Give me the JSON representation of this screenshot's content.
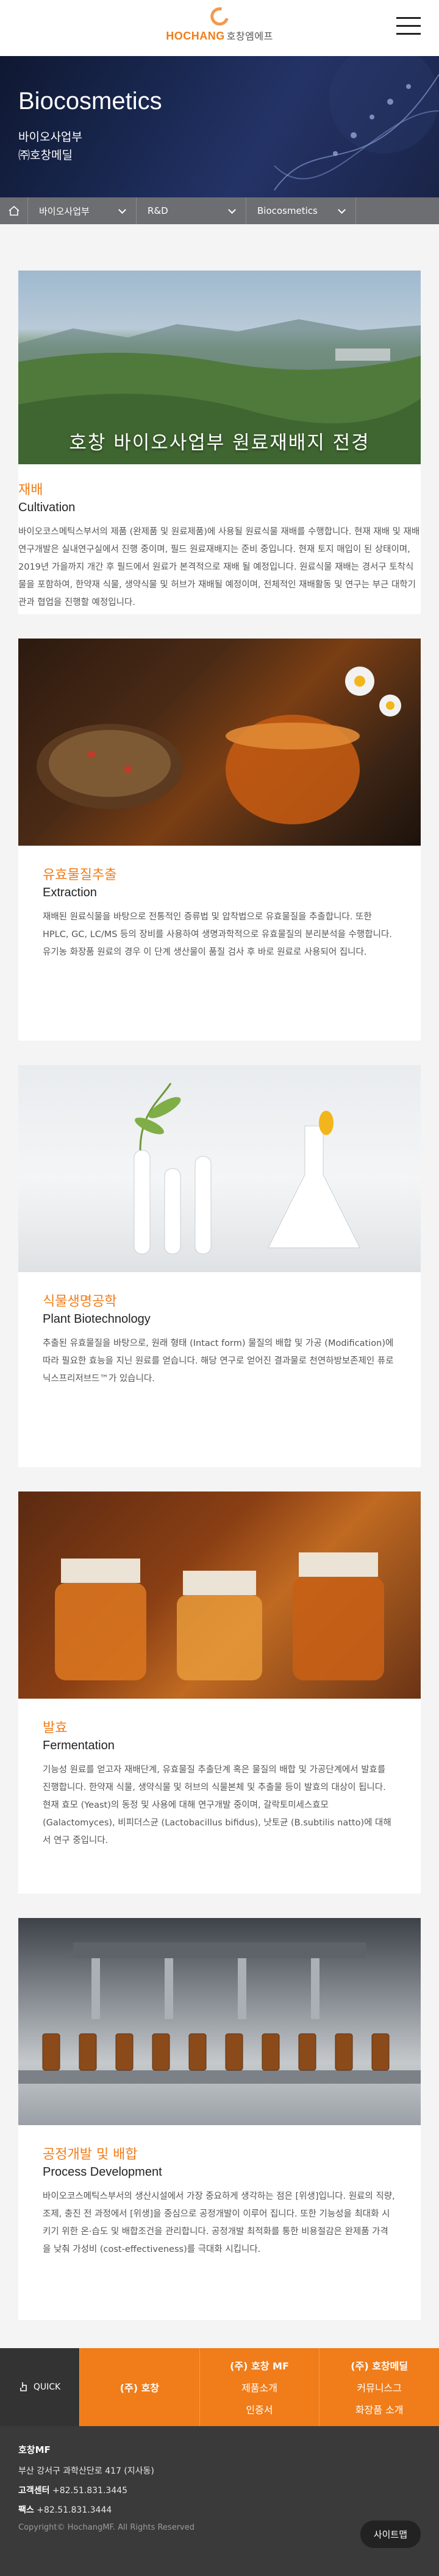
{
  "brand": {
    "name": "HOCHANG",
    "sub": "호창엠에프"
  },
  "hero": {
    "title": "Biocosmetics",
    "line1": "바이오사업부",
    "line2": "㈜호창메딜"
  },
  "breadcrumb": {
    "items": [
      "바이오사업부",
      "R&D",
      "Biocosmetics"
    ]
  },
  "intro": {
    "caption": "호창 바이오사업부 원료재배지 전경",
    "title": "재배",
    "title_en": "Cultivation",
    "body": "바이오코스메틱스부서의 제품 (완제품 및 원료제품)에 사용될 원료식물 재배를 수행합니다. 현재 재배 및 재배 연구개발은 실내연구실에서 진행 중이며, 필드 원료재배지는 준비 중입니다. 현재 토지 매입이 된 상태이며, 2019년 가을까지 개간 후 필드에서 원료가 본격적으로 재배 될 예정입니다. 원료식물 재배는 경서구 토착식물을 포함하여, 한약재 식물, 생약식물 및 허브가 재배될 예정이며, 전체적인 재배활동 및 연구는 부근 대학기관과 협업을 진행할 예정입니다."
  },
  "sections": [
    {
      "title": "유효물질추출",
      "title_en": "Extraction",
      "body": "재배된 원료식물을 바탕으로 전통적인 증류법 및 압착법으로 유효물질을 추출합니다. 또한 HPLC, GC, LC/MS 등의 장비를 사용하여 생명과학적으로 유효물질의 분리분석을 수행합니다. 유기농 화장품 원료의 경우 이 단계 생산물이 품질 검사 후 바로 원료로 사용되어 집니다."
    },
    {
      "title": "식물생명공학",
      "title_en": "Plant Biotechnology",
      "body": "추출된 유효물질을 바탕으로, 원래 형태 (Intact form) 물질의 배합 및 가공 (Modification)에 따라 필요한 효능을 지닌 원료를 얻습니다. 해당 연구로 얻어진 결과물로 천연하방보존제인 퓨로닉스프리저브드™가 있습니다."
    },
    {
      "title": "발효",
      "title_en": "Fermentation",
      "body": "기능성 원료를 얻고자 재배단계, 유효물질 추출단계 혹은 물질의 배합 및 가공단계에서 발효를 진행합니다. 한약재 식물, 생약식물 및 허브의 식물본체 및 추출물 등이 발효의 대상이 됩니다. 현재 효모 (Yeast)의 동정 및 사용에 대해 연구개발 중이며, 갈락토미세스효모 (Galactomyces), 비피더스균 (Lactobacillus bifidus), 낫토균 (B.subtilis natto)에 대해서 연구 중입니다."
    },
    {
      "title": "공정개발 및 배합",
      "title_en": "Process Development",
      "body": "바이오코스메틱스부서의 생산시설에서 가장 중요하게 생각하는 점은 [위생]입니다. 원료의 직량, 조제, 충진 전 과정에서 [위생]을 중심으로 공정개발이 이루어 집니다. 또한 기능성을 최대화 시키기 위한 온·습도 및 배합조건을 관리합니다. 공정개발 최적화를 통한 비용절감은 완제품 가격을 낮춰 가성비 (cost-effectiveness)를 극대화 시킵니다."
    }
  ],
  "quick": {
    "label": "QUICK",
    "col1": {
      "title": "(주) 호창",
      "links": []
    },
    "col2": {
      "title": "(주) 호창 MF",
      "links": [
        "제품소개",
        "인증서"
      ]
    },
    "col3": {
      "title": "(주) 호창메딜",
      "links": [
        "커뮤니스그",
        "화장품 소개"
      ]
    }
  },
  "footer": {
    "company": "호창MF",
    "address": "부산 강서구 과학산단로 417 (지사동)",
    "phone_label": "고객센터",
    "phone": "+82.51.831.3445",
    "fax_label": "팩스",
    "fax": "+82.51.831.3444",
    "copyright": "Copyright© HochangMF. All Rights Reserved",
    "sitemap": "사이트맵"
  },
  "colors": {
    "accent": "#f07d1a",
    "breadcrumb": "#6d6e71",
    "footer": "#3a3a3a"
  }
}
